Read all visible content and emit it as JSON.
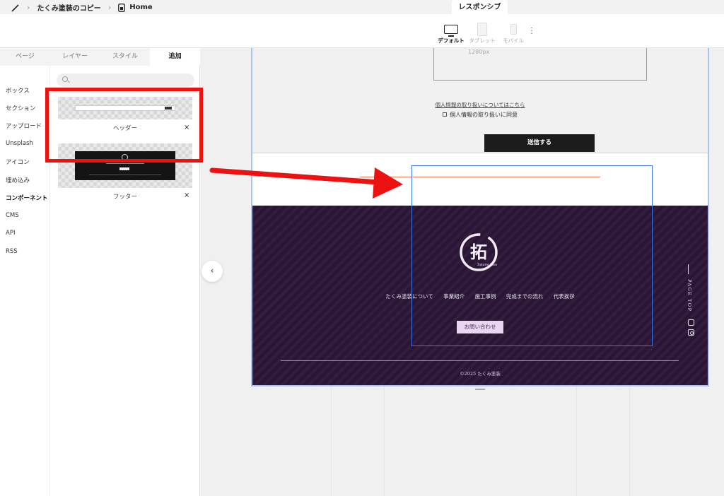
{
  "breadcrumb": {
    "project": "たくみ塗装のコピー",
    "page": "Home"
  },
  "responsive": {
    "tab_label": "レスポンシブ",
    "devices": [
      {
        "label": "デフォルト",
        "active": true
      },
      {
        "label": "タブレット",
        "active": false
      },
      {
        "label": "モバイル",
        "active": false
      }
    ]
  },
  "panel": {
    "tabs": [
      {
        "label": "ページ"
      },
      {
        "label": "レイヤー"
      },
      {
        "label": "スタイル"
      },
      {
        "label": "追加",
        "active": true
      }
    ],
    "categories": [
      {
        "label": "ボックス"
      },
      {
        "label": "セクション"
      },
      {
        "label": "アップロード"
      },
      {
        "label": "Unsplash"
      },
      {
        "label": "アイコン"
      },
      {
        "label": "埋め込み"
      },
      {
        "label": "コンポーネント",
        "active": true
      },
      {
        "label": "CMS"
      },
      {
        "label": "API"
      },
      {
        "label": "RSS"
      }
    ],
    "components": [
      {
        "label": "ヘッダー",
        "close": "×"
      },
      {
        "label": "フッター",
        "close": "×"
      }
    ]
  },
  "canvas": {
    "map_width_label": "1280px",
    "privacy_link": "個人情報の取り扱いについてはこちら",
    "agree_label": "個人情報の取り扱いに同意",
    "submit_label": "送信する",
    "footer": {
      "nav": [
        "たくみ塗装について",
        "事業紹介",
        "施工事例",
        "完成までの流れ",
        "代表挨拶"
      ],
      "contact_label": "お問い合わせ",
      "page_top": "PAGE TOP",
      "copyright": "©2025 たくみ塗装",
      "logo_char": "拓",
      "logo_sub": "Takumi Toso"
    }
  },
  "colors": {
    "highlight_red": "#ee1111",
    "footer_bg": "#2a1536",
    "selection_blue": "#3b74e8",
    "accent_orange": "#ec7b55"
  }
}
